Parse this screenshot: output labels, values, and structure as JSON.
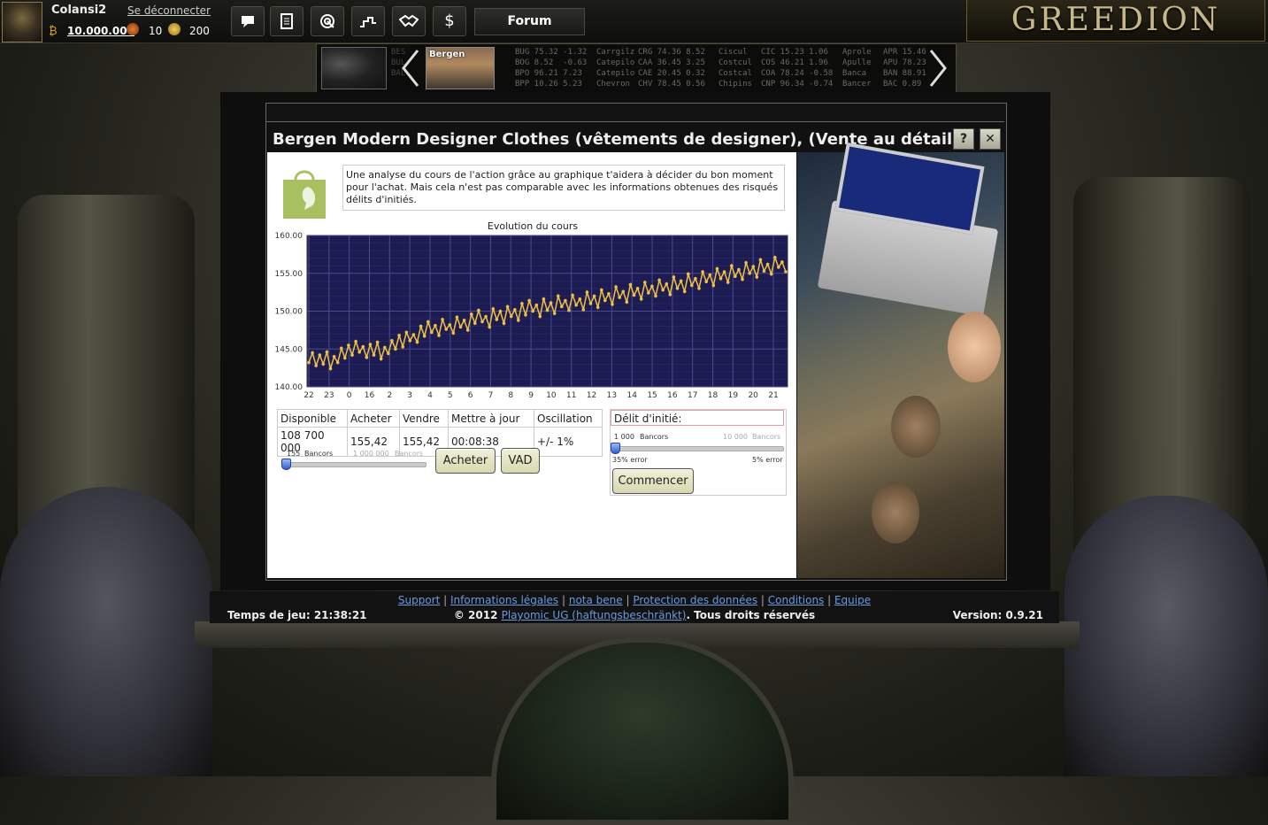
{
  "user": {
    "name": "Colansi2",
    "logout": "Se déconnecter",
    "money": "10.000.000",
    "rank": "10",
    "gold": "200"
  },
  "nav": {
    "forum": "Forum",
    "dollar_symbol": "$"
  },
  "logo": "GREEDION",
  "ticker": {
    "map_text": [
      "BES",
      "BUL",
      "BAL"
    ],
    "city": "Bergen",
    "columns": [
      "BUG 75.32 -1.32\nBOG 8.52  -0.63\nBPO 96.21 7.23\nBPP 10.26 5.23",
      "Carrgilz\nCatepilo\nCatepilo\nChevron",
      "CRG 74.36 8.52\nCAA 36.45 3.25\nCAE 20.45 0.32\nCHV 78.45 0.56",
      "Ciscul\nCostcul\nCostcal\nChipins",
      "CIC 15.23 1.06\nCOS 46.21 1.96\nCOA 78.24 -0.58\nCNP 96.34 -0.74",
      "Aprole\nApulle\nBanca\nBancer",
      "APR 15.46\nAPU 78.23\nBAN 88.91\nBAC 0.89"
    ]
  },
  "dialog": {
    "title": "Bergen Modern Designer Clothes (vêtements de designer), (Vente au détail)",
    "help": "?",
    "close": "✕",
    "info": "Une analyse du cours de l'action grâce au graphique t'aidera à décider du bon moment pour l'achat. Mais cela n'est pas comparable avec les informations obtenues des risqués délits d'initiés."
  },
  "chart_data": {
    "type": "line",
    "title": "Evolution du cours",
    "xlabel": "",
    "ylabel": "",
    "ylim": [
      140,
      160
    ],
    "yticks": [
      "160.00",
      "155.00",
      "150.00",
      "145.00",
      "140.00"
    ],
    "xticks": [
      "22",
      "23",
      "0",
      "16",
      "2",
      "3",
      "4",
      "5",
      "6",
      "7",
      "8",
      "9",
      "10",
      "11",
      "12",
      "13",
      "14",
      "15",
      "16",
      "17",
      "18",
      "19",
      "20",
      "21"
    ],
    "grid": true,
    "line_color": "#f0c040",
    "background": "#1c1c52",
    "values": [
      143.2,
      144.5,
      142.8,
      144.2,
      143.0,
      144.6,
      142.4,
      144.0,
      143.2,
      145.1,
      143.8,
      145.5,
      144.2,
      146.0,
      144.6,
      145.3,
      143.9,
      145.6,
      144.2,
      145.9,
      143.7,
      145.2,
      144.4,
      146.1,
      145.0,
      146.8,
      145.3,
      147.2,
      146.1,
      146.9,
      145.9,
      148.0,
      146.7,
      148.6,
      147.2,
      148.1,
      146.8,
      148.9,
      147.6,
      148.2,
      147.1,
      149.2,
      147.9,
      148.8,
      147.5,
      149.6,
      148.4,
      150.1,
      148.6,
      149.3,
      147.9,
      150.3,
      148.9,
      150.0,
      148.4,
      150.6,
      149.3,
      150.2,
      148.8,
      151.0,
      149.5,
      151.4,
      150.0,
      150.8,
      149.3,
      151.6,
      150.1,
      151.1,
      149.7,
      152.0,
      150.6,
      151.4,
      150.1,
      152.1,
      150.8,
      151.6,
      150.2,
      152.5,
      151.0,
      152.0,
      150.5,
      152.8,
      151.4,
      152.3,
      150.9,
      153.2,
      151.8,
      152.6,
      151.2,
      153.5,
      152.1,
      153.0,
      151.6,
      153.8,
      152.4,
      153.3,
      152.0,
      154.1,
      152.8,
      153.6,
      152.2,
      154.5,
      153.0,
      154.0,
      152.6,
      154.9,
      153.4,
      154.3,
      153.0,
      155.2,
      153.9,
      154.8,
      153.4,
      155.6,
      154.3,
      155.2,
      153.8,
      156.0,
      154.6,
      155.5,
      154.2,
      156.4,
      155.0,
      155.9,
      154.5,
      156.8,
      155.3,
      156.2,
      154.9,
      157.1,
      155.8,
      156.5,
      155.2
    ]
  },
  "table": {
    "headers": [
      "Disponible",
      "Acheter",
      "Vendre",
      "Mettre à jour",
      "Oscillation"
    ],
    "values": [
      "108 700 000",
      "155,42",
      "155,42",
      "00:08:38",
      "+/- 1%"
    ]
  },
  "buy_slider": {
    "min_value": "155",
    "min_unit": "Bancors",
    "max_value": "1 000 000",
    "max_unit": "Bancors",
    "position": 0
  },
  "buttons": {
    "buy": "Acheter",
    "sell": "VAD",
    "start": "Commencer"
  },
  "insider": {
    "title": "Délit d'initié:",
    "min_value": "1 000",
    "min_unit": "Bancors",
    "max_value": "10 000",
    "max_unit": "Bancors",
    "min_error": "35% error",
    "max_error": "5% error",
    "position": 0
  },
  "footer": {
    "links": [
      "Support",
      "Informations légales",
      "nota bene",
      "Protection des données",
      "Conditions",
      "Equipe"
    ],
    "time_label": "Temps de jeu: 21:38:21",
    "copyright_prefix": "© 2012 ",
    "copyright_link": "Playomic UG (haftungsbeschränkt)",
    "copyright_suffix": ". Tous droits réservés",
    "version": "Version: 0.9.21"
  }
}
